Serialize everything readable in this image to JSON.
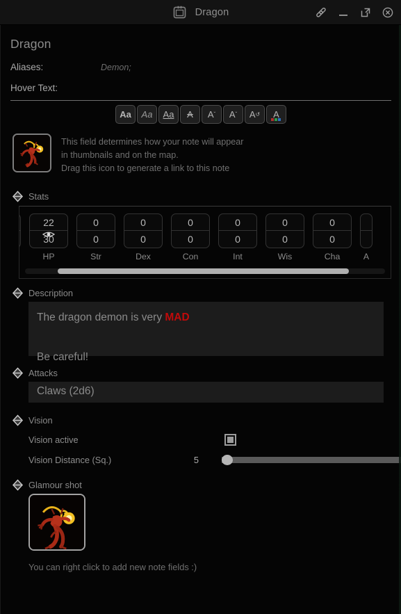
{
  "window": {
    "title": "Dragon",
    "icon": "note-icon",
    "controls": [
      {
        "name": "link-icon",
        "label": "Link"
      },
      {
        "name": "minimize-icon",
        "label": "Minimize"
      },
      {
        "name": "popout-icon",
        "label": "Pop out"
      },
      {
        "name": "close-icon",
        "label": "Close"
      }
    ]
  },
  "note": {
    "title": "Dragon",
    "aliases_label": "Aliases:",
    "aliases_value": "Demon;",
    "hover_text_label": "Hover Text:",
    "hover_text_value": ""
  },
  "format_toolbar": [
    {
      "name": "bold-button",
      "glyph": "Aa",
      "style": "bold"
    },
    {
      "name": "italic-button",
      "glyph": "Aa",
      "style": "italic"
    },
    {
      "name": "underline-button",
      "glyph": "Aa",
      "style": "underline"
    },
    {
      "name": "strikethrough-button",
      "glyph": "A",
      "style": "strike"
    },
    {
      "name": "superscript-button",
      "glyph": "A",
      "style": "superscript",
      "mark": "ˇ"
    },
    {
      "name": "subscript-button",
      "glyph": "A",
      "style": "subscript",
      "mark": "ˇ"
    },
    {
      "name": "clear-format-button",
      "glyph": "A",
      "style": "circle",
      "mark": "↺"
    },
    {
      "name": "text-color-button",
      "glyph": "A",
      "style": "color"
    }
  ],
  "color_swatches": [
    "#b03030",
    "#2f9a4a",
    "#2f6fc0"
  ],
  "icon_field": {
    "hint_line1": "This field determines how your note will appear",
    "hint_line2": "in thumbnails and on the map.",
    "hint_line3": "Drag this icon to generate a link to this note"
  },
  "sections": {
    "stats": {
      "label": "Stats",
      "scroll_position_pct": 9,
      "stats": [
        {
          "name": "HP",
          "current": "22",
          "max": "30",
          "has_eye": true
        },
        {
          "name": "Str",
          "current": "0",
          "max": "0",
          "has_eye": false
        },
        {
          "name": "Dex",
          "current": "0",
          "max": "0",
          "has_eye": false
        },
        {
          "name": "Con",
          "current": "0",
          "max": "0",
          "has_eye": false
        },
        {
          "name": "Int",
          "current": "0",
          "max": "0",
          "has_eye": false
        },
        {
          "name": "Wis",
          "current": "0",
          "max": "0",
          "has_eye": false
        },
        {
          "name": "Cha",
          "current": "0",
          "max": "0",
          "has_eye": false
        },
        {
          "name": "A",
          "current": "",
          "max": "",
          "has_eye": false
        }
      ]
    },
    "description": {
      "label": "Description",
      "line1_plain": "The dragon demon is very ",
      "line1_accent": "MAD",
      "line2": "Be careful!",
      "accent_color": "#c00a0a"
    },
    "attacks": {
      "label": "Attacks",
      "value": "Claws (2d6)"
    },
    "vision": {
      "label": "Vision",
      "active_label": "Vision active",
      "active_checked": true,
      "distance_label": "Vision Distance (Sq.)",
      "distance_value": "5",
      "slider_position_pct": 0
    },
    "glamour": {
      "label": "Glamour shot",
      "image_alt": "fire demon"
    }
  },
  "footer_hint": "You can right click to add new note fields :)"
}
